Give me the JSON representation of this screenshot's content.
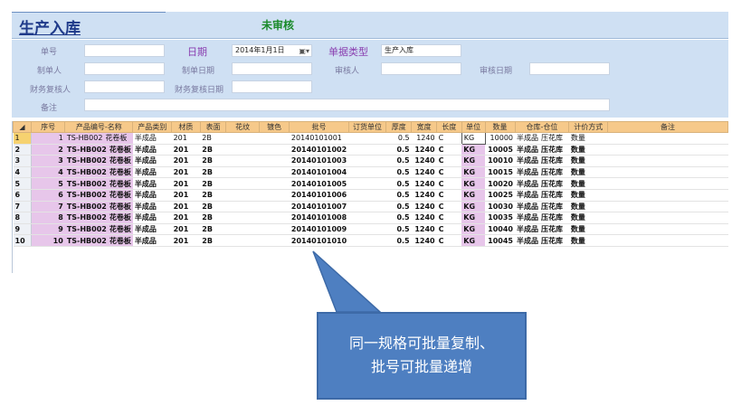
{
  "header": {
    "title": "生产入库",
    "status": "未审核"
  },
  "form": {
    "bill_no_label": "单号",
    "bill_no_value": "",
    "date_label": "日期",
    "date_value": "2014年1月1日",
    "bill_type_label": "单据类型",
    "bill_type_value": "生产入库",
    "creator_label": "制单人",
    "creator_value": "",
    "create_date_label": "制单日期",
    "create_date_value": "",
    "reviewer_label": "审核人",
    "reviewer_value": "",
    "review_date_label": "审核日期",
    "review_date_value": "",
    "fin_reviewer_label": "财务复核人",
    "fin_reviewer_value": "",
    "fin_review_date_label": "财务复核日期",
    "fin_review_date_value": "",
    "remark_label": "备注",
    "remark_value": ""
  },
  "grid": {
    "columns": [
      "",
      "序号",
      "产品编号-名称",
      "产品类别",
      "材质",
      "表面",
      "花纹",
      "镀色",
      "批号",
      "订货单位",
      "厚度",
      "宽度",
      "长度",
      "单位",
      "数量",
      "仓库-仓位",
      "计价方式",
      "备注"
    ],
    "rows": [
      {
        "rn": "1",
        "seq": "1",
        "code": "TS-HB002",
        "name": "花卷板",
        "cat": "半成品",
        "mat": "201",
        "surf": "2B",
        "pat": "",
        "plat": "",
        "batch": "20140101001",
        "cust": "",
        "thk": "0.5",
        "wid": "1240",
        "len": "C",
        "unit": "KG",
        "qty": "10000",
        "wh": "半成品",
        "pos": "压花库",
        "price": "数量",
        "note": ""
      },
      {
        "rn": "2",
        "seq": "2",
        "code": "TS-HB002",
        "name": "花卷板",
        "cat": "半成品",
        "mat": "201",
        "surf": "2B",
        "pat": "",
        "plat": "",
        "batch": "20140101002",
        "cust": "",
        "thk": "0.5",
        "wid": "1240",
        "len": "C",
        "unit": "KG",
        "qty": "10005",
        "wh": "半成品",
        "pos": "压花库",
        "price": "数量",
        "note": ""
      },
      {
        "rn": "3",
        "seq": "3",
        "code": "TS-HB002",
        "name": "花卷板",
        "cat": "半成品",
        "mat": "201",
        "surf": "2B",
        "pat": "",
        "plat": "",
        "batch": "20140101003",
        "cust": "",
        "thk": "0.5",
        "wid": "1240",
        "len": "C",
        "unit": "KG",
        "qty": "10010",
        "wh": "半成品",
        "pos": "压花库",
        "price": "数量",
        "note": ""
      },
      {
        "rn": "4",
        "seq": "4",
        "code": "TS-HB002",
        "name": "花卷板",
        "cat": "半成品",
        "mat": "201",
        "surf": "2B",
        "pat": "",
        "plat": "",
        "batch": "20140101004",
        "cust": "",
        "thk": "0.5",
        "wid": "1240",
        "len": "C",
        "unit": "KG",
        "qty": "10015",
        "wh": "半成品",
        "pos": "压花库",
        "price": "数量",
        "note": ""
      },
      {
        "rn": "5",
        "seq": "5",
        "code": "TS-HB002",
        "name": "花卷板",
        "cat": "半成品",
        "mat": "201",
        "surf": "2B",
        "pat": "",
        "plat": "",
        "batch": "20140101005",
        "cust": "",
        "thk": "0.5",
        "wid": "1240",
        "len": "C",
        "unit": "KG",
        "qty": "10020",
        "wh": "半成品",
        "pos": "压花库",
        "price": "数量",
        "note": ""
      },
      {
        "rn": "6",
        "seq": "6",
        "code": "TS-HB002",
        "name": "花卷板",
        "cat": "半成品",
        "mat": "201",
        "surf": "2B",
        "pat": "",
        "plat": "",
        "batch": "20140101006",
        "cust": "",
        "thk": "0.5",
        "wid": "1240",
        "len": "C",
        "unit": "KG",
        "qty": "10025",
        "wh": "半成品",
        "pos": "压花库",
        "price": "数量",
        "note": ""
      },
      {
        "rn": "7",
        "seq": "7",
        "code": "TS-HB002",
        "name": "花卷板",
        "cat": "半成品",
        "mat": "201",
        "surf": "2B",
        "pat": "",
        "plat": "",
        "batch": "20140101007",
        "cust": "",
        "thk": "0.5",
        "wid": "1240",
        "len": "C",
        "unit": "KG",
        "qty": "10030",
        "wh": "半成品",
        "pos": "压花库",
        "price": "数量",
        "note": ""
      },
      {
        "rn": "8",
        "seq": "8",
        "code": "TS-HB002",
        "name": "花卷板",
        "cat": "半成品",
        "mat": "201",
        "surf": "2B",
        "pat": "",
        "plat": "",
        "batch": "20140101008",
        "cust": "",
        "thk": "0.5",
        "wid": "1240",
        "len": "C",
        "unit": "KG",
        "qty": "10035",
        "wh": "半成品",
        "pos": "压花库",
        "price": "数量",
        "note": ""
      },
      {
        "rn": "9",
        "seq": "9",
        "code": "TS-HB002",
        "name": "花卷板",
        "cat": "半成品",
        "mat": "201",
        "surf": "2B",
        "pat": "",
        "plat": "",
        "batch": "20140101009",
        "cust": "",
        "thk": "0.5",
        "wid": "1240",
        "len": "C",
        "unit": "KG",
        "qty": "10040",
        "wh": "半成品",
        "pos": "压花库",
        "price": "数量",
        "note": ""
      },
      {
        "rn": "10",
        "seq": "10",
        "code": "TS-HB002",
        "name": "花卷板",
        "cat": "半成品",
        "mat": "201",
        "surf": "2B",
        "pat": "",
        "plat": "",
        "batch": "20140101010",
        "cust": "",
        "thk": "0.5",
        "wid": "1240",
        "len": "C",
        "unit": "KG",
        "qty": "10045",
        "wh": "半成品",
        "pos": "压花库",
        "price": "数量",
        "note": ""
      }
    ]
  },
  "callout": {
    "line1": "同一规格可批量复制、",
    "line2": "批号可批量递增"
  },
  "colors": {
    "header_bg": "#cfe0f3",
    "title": "#1f3a8a",
    "status": "#1a8a2a",
    "grid_header": "#f6c98a",
    "pink_cell": "#e7c6ea",
    "callout": "#4e7fc1"
  },
  "icons": {
    "date_dropdown": "calendar-dropdown-icon"
  }
}
